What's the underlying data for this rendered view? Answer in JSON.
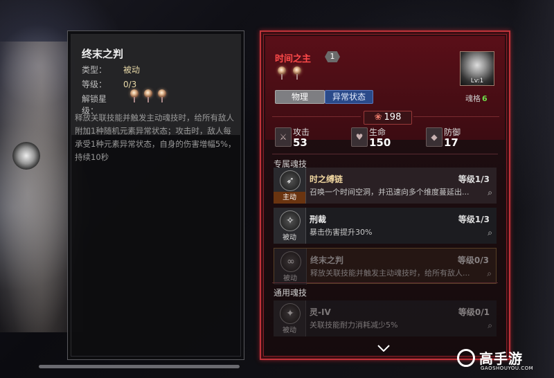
{
  "detail_panel": {
    "title": "终末之判",
    "type_label": "类型：",
    "type_value": "被动",
    "level_label": "等级：",
    "level_value": "0/3",
    "unlock_label": "解锁星级：",
    "description": "释放关联技能并触发主动魂技时，给所有敌人附加1种随机元素异常状态；攻击时，敌人每承受1种元素异常状态，自身的伤害增幅5%，持续10秒"
  },
  "character": {
    "name": "时间之主",
    "star_level": "1",
    "portrait_level": "Lv:1",
    "soul_grid_label": "魂格",
    "soul_grid_value": "6",
    "tags": [
      "物理",
      "异常状态"
    ],
    "power": "198",
    "stats": {
      "attack_label": "攻击",
      "attack_value": "53",
      "hp_label": "生命",
      "hp_value": "150",
      "defense_label": "防御",
      "defense_value": "17"
    }
  },
  "sections": {
    "exclusive": "专属魂技",
    "general": "通用魂技"
  },
  "skills": [
    {
      "name": "时之缚链",
      "level": "等级1/3",
      "kind": "主动",
      "desc": "召唤一个时间空洞，并迅速向多个维度蔓延出..."
    },
    {
      "name": "刑裁",
      "level": "等级1/3",
      "kind": "被动",
      "desc": "暴击伤害提升30%"
    },
    {
      "name": "终末之判",
      "level": "等级0/3",
      "kind": "被动",
      "desc": "释放关联技能并触发主动魂技时，给所有敌人..."
    },
    {
      "name": "灵-IV",
      "level": "等级0/1",
      "kind": "被动",
      "desc": "关联技能耐力消耗减少5%"
    }
  ],
  "icons": {
    "zoom": "magnifier-plus-icon",
    "chevron": "chevron-down-icon"
  },
  "colors": {
    "card_border": "#c0343a",
    "name_red": "#ff4a4a",
    "soul_green": "#6fdc4a",
    "active_tag": "#6a3410"
  },
  "watermark": {
    "text": "高手游",
    "url": "GAOSHOUYOU.COM"
  }
}
